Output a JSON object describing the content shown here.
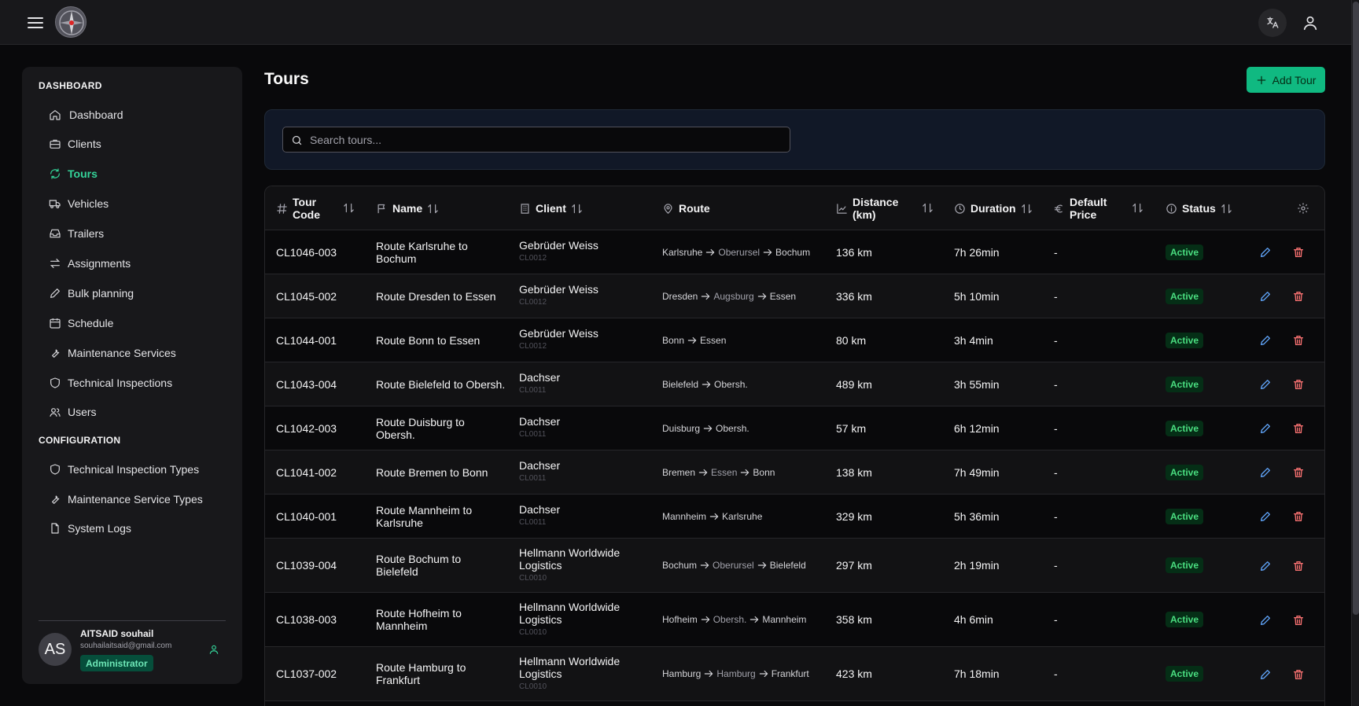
{
  "sidebar": {
    "sections": [
      {
        "title": "DASHBOARD",
        "items": [
          "Dashboard",
          "Clients",
          "Tours",
          "Vehicles",
          "Trailers",
          "Assignments",
          "Bulk planning",
          "Schedule",
          "Maintenance Services",
          "Technical Inspections",
          "Users"
        ]
      },
      {
        "title": "CONFIGURATION",
        "items": [
          "Technical Inspection Types",
          "Maintenance Service Types",
          "System Logs"
        ]
      }
    ],
    "active_item": "Tours",
    "user": {
      "initials": "AS",
      "name": "AITSAID souhail",
      "email": "souhailaitsaid@gmail.com",
      "role": "Administrator"
    }
  },
  "page": {
    "title": "Tours",
    "add_button": "Add Tour",
    "search_placeholder": "Search tours..."
  },
  "table": {
    "headers": {
      "tour_code": "Tour Code",
      "name": "Name",
      "client": "Client",
      "route": "Route",
      "distance": "Distance (km)",
      "duration": "Duration",
      "default_price": "Default Price",
      "status": "Status"
    },
    "rows": [
      {
        "code": "CL1046-003",
        "name": "Route Karlsruhe to Bochum",
        "client": "Gebrüder Weiss",
        "client_code": "CL0012",
        "route": [
          "Karlsruhe",
          "Oberursel",
          "Bochum"
        ],
        "distance": "136 km",
        "duration": "7h 26min",
        "price": "-",
        "status": "Active"
      },
      {
        "code": "CL1045-002",
        "name": "Route Dresden to Essen",
        "client": "Gebrüder Weiss",
        "client_code": "CL0012",
        "route": [
          "Dresden",
          "Augsburg",
          "Essen"
        ],
        "distance": "336 km",
        "duration": "5h 10min",
        "price": "-",
        "status": "Active"
      },
      {
        "code": "CL1044-001",
        "name": "Route Bonn to Essen",
        "client": "Gebrüder Weiss",
        "client_code": "CL0012",
        "route": [
          "Bonn",
          "Essen"
        ],
        "distance": "80 km",
        "duration": "3h 4min",
        "price": "-",
        "status": "Active"
      },
      {
        "code": "CL1043-004",
        "name": "Route Bielefeld to Obersh.",
        "client": "Dachser",
        "client_code": "CL0011",
        "route": [
          "Bielefeld",
          "Obersh."
        ],
        "distance": "489 km",
        "duration": "3h 55min",
        "price": "-",
        "status": "Active"
      },
      {
        "code": "CL1042-003",
        "name": "Route Duisburg to Obersh.",
        "client": "Dachser",
        "client_code": "CL0011",
        "route": [
          "Duisburg",
          "Obersh."
        ],
        "distance": "57 km",
        "duration": "6h 12min",
        "price": "-",
        "status": "Active"
      },
      {
        "code": "CL1041-002",
        "name": "Route Bremen to Bonn",
        "client": "Dachser",
        "client_code": "CL0011",
        "route": [
          "Bremen",
          "Essen",
          "Bonn"
        ],
        "distance": "138 km",
        "duration": "7h 49min",
        "price": "-",
        "status": "Active"
      },
      {
        "code": "CL1040-001",
        "name": "Route Mannheim to Karlsruhe",
        "client": "Dachser",
        "client_code": "CL0011",
        "route": [
          "Mannheim",
          "Karlsruhe"
        ],
        "distance": "329 km",
        "duration": "5h 36min",
        "price": "-",
        "status": "Active"
      },
      {
        "code": "CL1039-004",
        "name": "Route Bochum to Bielefeld",
        "client": "Hellmann Worldwide Logistics",
        "client_code": "CL0010",
        "route": [
          "Bochum",
          "Oberursel",
          "Bielefeld"
        ],
        "distance": "297 km",
        "duration": "2h 19min",
        "price": "-",
        "status": "Active"
      },
      {
        "code": "CL1038-003",
        "name": "Route Hofheim to Mannheim",
        "client": "Hellmann Worldwide Logistics",
        "client_code": "CL0010",
        "route": [
          "Hofheim",
          "Obersh.",
          "Mannheim"
        ],
        "distance": "358 km",
        "duration": "4h 6min",
        "price": "-",
        "status": "Active"
      },
      {
        "code": "CL1037-002",
        "name": "Route Hamburg to Frankfurt",
        "client": "Hellmann Worldwide Logistics",
        "client_code": "CL0010",
        "route": [
          "Hamburg",
          "Hamburg",
          "Frankfurt"
        ],
        "distance": "423 km",
        "duration": "7h 18min",
        "price": "-",
        "status": "Active"
      }
    ]
  },
  "icons": {
    "nav": [
      "home-icon",
      "briefcase-icon",
      "refresh-icon",
      "truck-icon",
      "inbox-icon",
      "swap-icon",
      "pencil-icon",
      "calendar-icon",
      "wrench-icon",
      "shield-icon",
      "users-icon",
      "shield-icon",
      "wrench-icon",
      "file-icon"
    ]
  },
  "colors": {
    "accent": "#10b981",
    "active_text": "#34d399",
    "edit": "#60a5fa",
    "delete": "#f87171"
  }
}
